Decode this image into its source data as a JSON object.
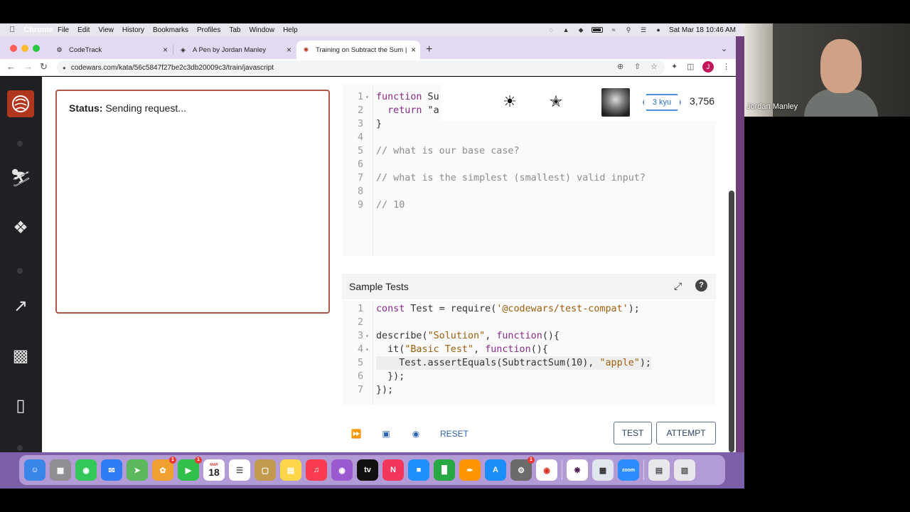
{
  "menubar": {
    "app": "Chrome",
    "items": [
      "File",
      "Edit",
      "View",
      "History",
      "Bookmarks",
      "Profiles",
      "Tab",
      "Window",
      "Help"
    ],
    "clock": "Sat Mar 18  10:46 AM"
  },
  "tabs": [
    {
      "title": "CodeTrack",
      "active": false
    },
    {
      "title": "A Pen by Jordan Manley",
      "active": false
    },
    {
      "title": "Training on Subtract the Sum |",
      "active": true
    }
  ],
  "address": {
    "url": "codewars.com/kata/56c5847f27be2c3db20009c3/train/javascript",
    "profile_initial": "J"
  },
  "output": {
    "status_label": "Status:",
    "status_text": "Sending request..."
  },
  "header": {
    "rank": "3 kyu",
    "honor": "3,756"
  },
  "solution_lines": [
    {
      "num": "1",
      "fold": true,
      "text": "function Su"
    },
    {
      "num": "2",
      "fold": false,
      "text": "  return \"a"
    },
    {
      "num": "3",
      "fold": false,
      "text": "}"
    },
    {
      "num": "4",
      "fold": false,
      "text": ""
    },
    {
      "num": "5",
      "fold": false,
      "text": "// what is our base case?"
    },
    {
      "num": "6",
      "fold": false,
      "text": ""
    },
    {
      "num": "7",
      "fold": false,
      "text": "// what is the simplest (smallest) valid input?"
    },
    {
      "num": "8",
      "fold": false,
      "text": ""
    },
    {
      "num": "9",
      "fold": false,
      "text": "// 10"
    }
  ],
  "sample_tests": {
    "title": "Sample Tests",
    "lines": [
      {
        "num": "1",
        "fold": false,
        "text": "const Test = require('@codewars/test-compat');"
      },
      {
        "num": "2",
        "fold": false,
        "text": ""
      },
      {
        "num": "3",
        "fold": true,
        "text": "describe(\"Solution\", function(){"
      },
      {
        "num": "4",
        "fold": true,
        "text": "  it(\"Basic Test\", function(){"
      },
      {
        "num": "5",
        "fold": false,
        "text": "    Test.assertEquals(SubtractSum(10), \"apple\");"
      },
      {
        "num": "6",
        "fold": false,
        "text": "  });"
      },
      {
        "num": "7",
        "fold": false,
        "text": "});"
      }
    ]
  },
  "actions": {
    "reset": "RESET",
    "test": "TEST",
    "attempt": "ATTEMPT"
  },
  "dock": {
    "calendar_month": "MAR",
    "calendar_day": "18",
    "apps": [
      "Finder",
      "Launchpad",
      "Messages",
      "Mail",
      "Maps",
      "Photos",
      "FaceTime",
      "Calendar",
      "Reminders",
      "Notes",
      "Stickies",
      "Music",
      "Podcasts",
      "TV",
      "News",
      "Keynote",
      "Numbers",
      "Pages",
      "App Store",
      "System Preferences",
      "Chrome",
      "Slack",
      "Preview",
      "Zoom",
      "Downloads",
      "Trash"
    ]
  },
  "video": {
    "name": "Jordan Manley"
  },
  "colors": {
    "output_border": "#b0574a",
    "rank_blue": "#4f8edb",
    "sidebar": "#1f2023",
    "tabstrip": "#e3d9f2"
  }
}
